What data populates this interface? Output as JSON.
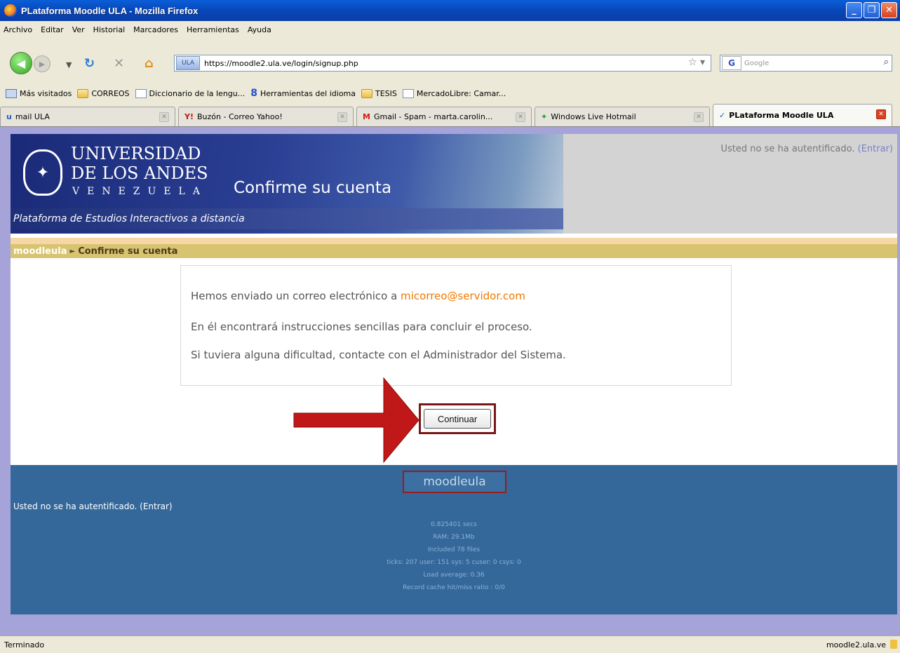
{
  "window": {
    "title": "PLataforma Moodle ULA - Mozilla Firefox"
  },
  "menu": [
    "Archivo",
    "Editar",
    "Ver",
    "Historial",
    "Marcadores",
    "Herramientas",
    "Ayuda"
  ],
  "navigation": {
    "url": "https://moodle2.ula.ve/login/signup.php",
    "search_placeholder": "Google"
  },
  "bookmarks": [
    {
      "label": "Más visitados",
      "icon": "history-icon"
    },
    {
      "label": "CORREOS",
      "icon": "folder-icon"
    },
    {
      "label": "Diccionario de la lengu...",
      "icon": "page-icon"
    },
    {
      "label": "Herramientas del idioma",
      "icon": "google-icon"
    },
    {
      "label": "TESIS",
      "icon": "folder-icon"
    },
    {
      "label": "MercadoLibre: Camar...",
      "icon": "page-icon"
    }
  ],
  "tabs": [
    {
      "label": "mail ULA",
      "active": false
    },
    {
      "label": "Buzón - Correo Yahoo!",
      "active": false
    },
    {
      "label": "Gmail - Spam - marta.carolin...",
      "active": false
    },
    {
      "label": "Windows Live Hotmail",
      "active": false
    },
    {
      "label": "PLataforma Moodle ULA",
      "active": true
    }
  ],
  "banner": {
    "uni_line1": "UNIVERSIDAD",
    "uni_line2": "DE LOS ANDES",
    "uni_line3": "VENEZUELA",
    "page_heading": "Confirme su cuenta",
    "platform": "Plataforma de Estudios Interactivos a distancia",
    "login_text": "Usted no se ha autentificado.",
    "login_link": "(Entrar)"
  },
  "breadcrumb": {
    "home": "moodleula",
    "separator": "►",
    "current": "Confirme su cuenta"
  },
  "message": {
    "line1_prefix": "Hemos enviado un correo electrónico a",
    "email": "micorreo@servidor.com",
    "line2": "En él encontrará instrucciones sencillas para concluir el proceso.",
    "line3": "Si tuviera alguna dificultad, contacte con el Administrador del Sistema."
  },
  "continue_button": "Continuar",
  "footer": {
    "logo": "moodleula",
    "login_text": "Usted no se ha autentificado.",
    "login_link": "(Entrar)",
    "perf": [
      "0.825401 secs",
      "RAM: 29.1Mb",
      "Included 78 files",
      "ticks: 207 user: 151 sys: 5 cuser: 0 csys: 0",
      "Load average: 0.36",
      "Record cache hit/miss ratio : 0/0"
    ]
  },
  "status": {
    "left": "Terminado",
    "right": "moodle2.ula.ve"
  },
  "colors": {
    "footer_bg": "#35689a",
    "nav_strip": "#d8c470",
    "email": "#f07a00",
    "arrow": "#c01818"
  }
}
